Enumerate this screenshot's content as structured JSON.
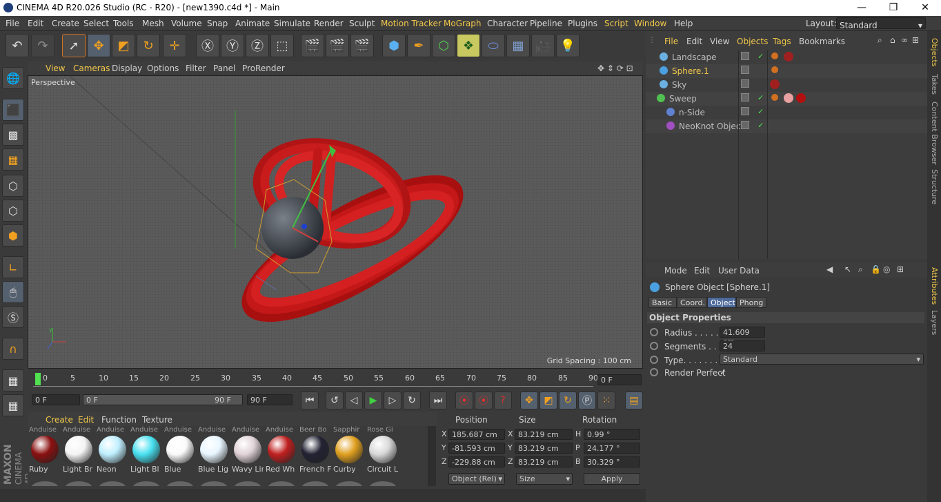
{
  "window": {
    "title": "CINEMA 4D R20.026 Studio (RC - R20) - [new1390.c4d *] - Main",
    "min": "—",
    "max": "❐",
    "close": "✕"
  },
  "menu": [
    "File",
    "Edit",
    "Create",
    "Select",
    "Tools",
    "Mesh",
    "Volume",
    "Snap",
    "Animate",
    "Simulate",
    "Render",
    "Sculpt",
    "Motion Tracker",
    "MoGraph",
    "Character",
    "Pipeline",
    "Plugins",
    "Script",
    "Window",
    "Help"
  ],
  "layout": {
    "label": "Layout:",
    "value": "Standard"
  },
  "viewport_menu": [
    "View",
    "Cameras",
    "Display",
    "Options",
    "Filter",
    "Panel",
    "ProRender"
  ],
  "viewport": {
    "name": "Perspective",
    "grid_spacing": "Grid Spacing : 100 cm"
  },
  "timeline": {
    "ticks": [
      "0",
      "5",
      "10",
      "15",
      "20",
      "25",
      "30",
      "35",
      "40",
      "45",
      "50",
      "55",
      "60",
      "65",
      "70",
      "75",
      "80",
      "85",
      "90"
    ],
    "current": "0 F"
  },
  "transport": {
    "start": "0 F",
    "range_start": "0 F",
    "range_end": "90 F",
    "end": "90 F"
  },
  "material_menu": [
    "Create",
    "Edit",
    "Function",
    "Texture"
  ],
  "materials": [
    {
      "top": "Anduise",
      "name": "Ruby",
      "color": "#8a1010"
    },
    {
      "top": "Anduise",
      "name": "Light Br",
      "color": "#f4f4f4"
    },
    {
      "top": "Anduise",
      "name": "Neon",
      "color": "#bfefff"
    },
    {
      "top": "Anduise",
      "name": "Light Bl",
      "color": "#48e0f0"
    },
    {
      "top": "Anduise",
      "name": "Blue",
      "color": "#fafafa"
    },
    {
      "top": "Anduise",
      "name": "Blue Lig",
      "color": "#e8f6ff"
    },
    {
      "top": "Anduise",
      "name": "Wavy Lir",
      "color": "#e0d2d6"
    },
    {
      "top": "Anduise",
      "name": "Red Wh",
      "color": "#c02020"
    },
    {
      "top": "Beer Bo",
      "name": "French F",
      "color": "#222233"
    },
    {
      "top": "Sapphir",
      "name": "Curby",
      "color": "#e0a020"
    },
    {
      "top": "Rose Gi",
      "name": "Circuit L",
      "color": "#d8d8d8"
    }
  ],
  "coords": {
    "headers": [
      "Position",
      "Size",
      "Rotation"
    ],
    "rows": [
      {
        "a": "X",
        "pos": "185.687 cm",
        "b": "X",
        "size": "83.219 cm",
        "c": "H",
        "rot": "0.99 °"
      },
      {
        "a": "Y",
        "pos": "-81.593 cm",
        "b": "Y",
        "size": "83.219 cm",
        "c": "P",
        "rot": "24.177 °"
      },
      {
        "a": "Z",
        "pos": "-229.88 cm",
        "b": "Z",
        "size": "83.219 cm",
        "c": "B",
        "rot": "30.329 °"
      }
    ],
    "mode": "Object (Rel)",
    "size_mode": "Size",
    "apply": "Apply"
  },
  "objects_menu": [
    "File",
    "Edit",
    "View",
    "Objects",
    "Tags",
    "Bookmarks"
  ],
  "objects": [
    {
      "name": "Landscape",
      "color": "#bbbbbb"
    },
    {
      "name": "Sphere.1",
      "color": "#f2c84b"
    },
    {
      "name": "Sky",
      "color": "#bbbbbb"
    },
    {
      "name": "Sweep",
      "color": "#bbbbbb"
    },
    {
      "name": "n-Side",
      "color": "#bbbbbb"
    },
    {
      "name": "NeoKnot Object",
      "color": "#bbbbbb"
    }
  ],
  "attr_menu": [
    "Mode",
    "Edit",
    "User Data"
  ],
  "attr": {
    "title": "Sphere Object [Sphere.1]",
    "tabs": [
      "Basic",
      "Coord.",
      "Object",
      "Phong"
    ],
    "section": "Object Properties",
    "radius_label": "Radius . . . . . . .",
    "radius": "41.609 cm",
    "segments_label": "Segments . . . .",
    "segments": "24",
    "type_label": "Type. . . . . . . . .",
    "type": "Standard",
    "render_label": "Render Perfect",
    "render_value": "✓"
  },
  "right_tabs": [
    "Objects",
    "Takes",
    "Content Browser",
    "Structure"
  ],
  "right_tabs2": [
    "Attributes",
    "Layers"
  ],
  "brand": {
    "maxon": "MAXON",
    "c4d": "CINEMA 4D"
  }
}
